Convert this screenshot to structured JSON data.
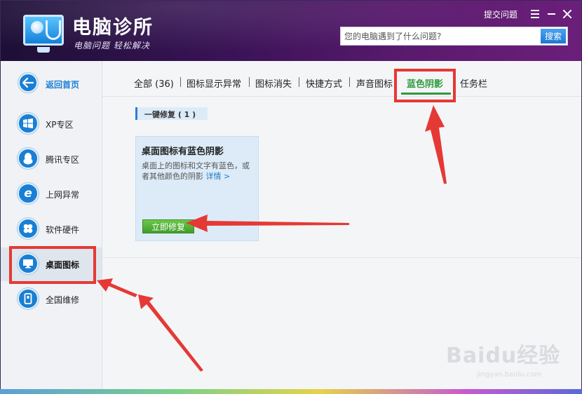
{
  "app": {
    "title": "电脑诊所",
    "slogan": "电脑问题 轻松解决",
    "submit_label": "提交问题"
  },
  "search": {
    "placeholder": "您的电脑遇到了什么问题?",
    "button_label": "搜索"
  },
  "sidebar": {
    "items": [
      {
        "label": "返回首页",
        "icon": "back-arrow-icon"
      },
      {
        "label": "XP专区",
        "icon": "windows-icon"
      },
      {
        "label": "腾讯专区",
        "icon": "penguin-icon"
      },
      {
        "label": "上网异常",
        "icon": "ie-icon"
      },
      {
        "label": "软件硬件",
        "icon": "puzzle-icon"
      },
      {
        "label": "桌面图标",
        "icon": "monitor-icon"
      },
      {
        "label": "全国维修",
        "icon": "phone-icon"
      }
    ]
  },
  "tabs": [
    {
      "label": "全部 (36)"
    },
    {
      "label": "图标显示异常"
    },
    {
      "label": "图标消失"
    },
    {
      "label": "快捷方式"
    },
    {
      "label": "声音图标"
    },
    {
      "label": "蓝色阴影"
    },
    {
      "label": "任务栏"
    }
  ],
  "section": {
    "title": "一键修复 ( 1 )"
  },
  "card": {
    "title": "桌面图标有蓝色阴影",
    "description": "桌面上的图标和文字有蓝色，或者其他颜色的阴影",
    "link_label": "详情 >",
    "button_label": "立即修复"
  },
  "watermark": {
    "text": "Baidu经验",
    "sub": "jingyan.baidu.com"
  },
  "colors": {
    "accent_blue": "#1a7fd4",
    "active_green": "#2f9a3c",
    "highlight_red": "#e53935"
  }
}
